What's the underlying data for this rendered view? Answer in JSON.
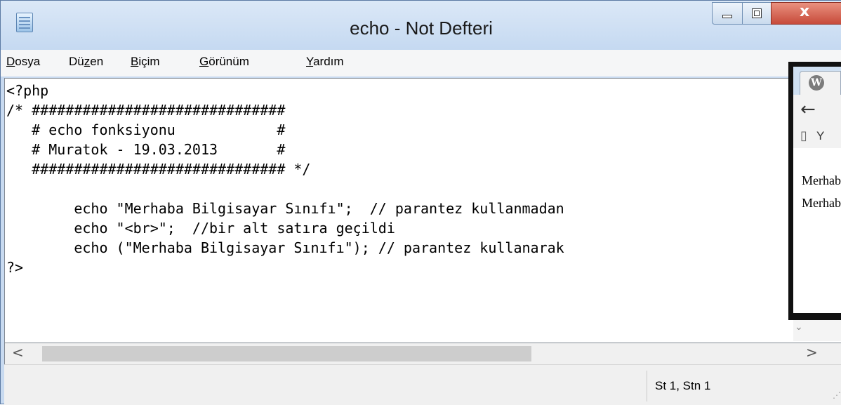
{
  "window": {
    "title": "echo - Not Defteri",
    "close_glyph": "x"
  },
  "menu": [
    {
      "pre": "",
      "accel": "D",
      "post": "osya"
    },
    {
      "pre": "Dü",
      "accel": "z",
      "post": "en"
    },
    {
      "pre": "",
      "accel": "B",
      "post": "içim"
    },
    {
      "pre": "",
      "accel": "G",
      "post": "örünüm"
    },
    {
      "pre": "",
      "accel": "Y",
      "post": "ardım"
    }
  ],
  "editor": {
    "code": "<?php\n/* ##############################\n   # echo fonksiyonu            #\n   # Muratok - 19.03.2013       #\n   ############################## */\n\n        echo \"Merhaba Bilgisayar Sınıfı\";  // parantez kullanmadan\n        echo \"<br>\";  //bir alt satıra geçildi\n        echo (\"Merhaba Bilgisayar Sınıfı\"); // parantez kullanarak\n?>"
  },
  "scrollbar": {
    "left_arrow": "<",
    "right_arrow": ">",
    "thumb_fraction": 0.6
  },
  "status": {
    "position": "St 1, Stn 1"
  },
  "browser_overlay": {
    "tab_icon": "wordpress-icon",
    "url_fragment": "Y",
    "content_lines": [
      "Merhaba Bilgisayar Sınıfı",
      "Merhaba Bilgisayar Sınıfı"
    ]
  },
  "colors": {
    "titlebar": "#c5d9f1",
    "close_button": "#c74a3a",
    "menubar": "#f5f6f7",
    "status_bar": "#f0f0f0"
  }
}
